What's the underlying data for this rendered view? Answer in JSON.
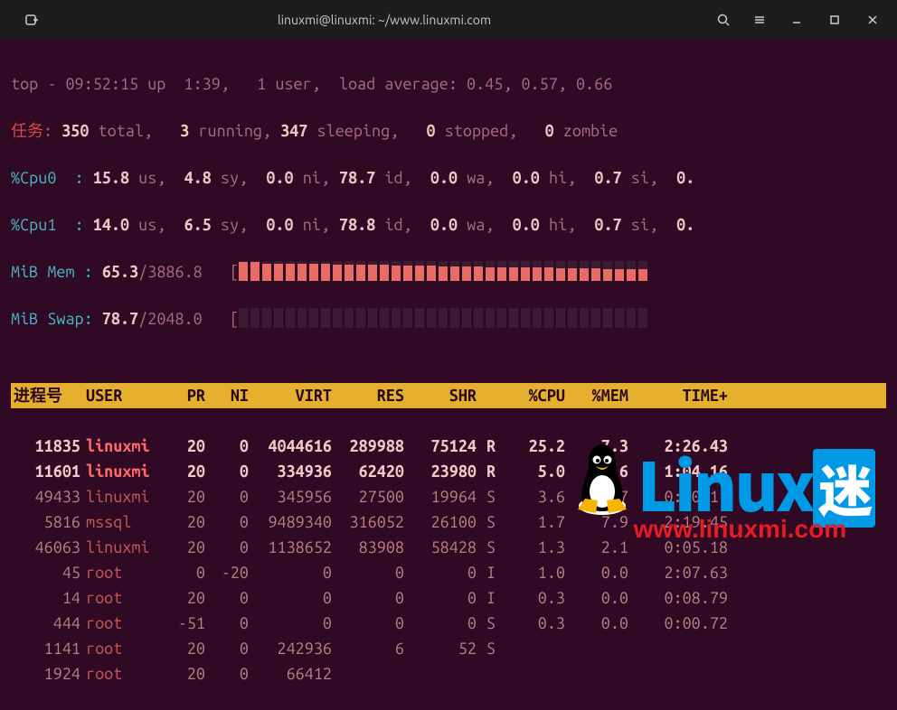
{
  "titlebar": {
    "title": "linuxmi@linuxmi: ~/www.linuxmi.com"
  },
  "top": {
    "line": "top - 09:52:15 up  1:39,   1 user,  load average: 0.45, 0.57, 0.66",
    "tasks": {
      "label": "任务:",
      "total": "350",
      "running": "3",
      "sleeping": "347",
      "stopped": "0",
      "zombie": "0"
    },
    "cpu0": {
      "label": "%Cpu0  :",
      "us": "15.8",
      "sy": "4.8",
      "ni": "0.0",
      "id": "78.7",
      "wa": "0.0",
      "hi": "0.0",
      "si": "0.7",
      "st": "0."
    },
    "cpu1": {
      "label": "%Cpu1  :",
      "us": "14.0",
      "sy": "6.5",
      "ni": "0.0",
      "id": "78.8",
      "wa": "0.0",
      "hi": "0.0",
      "si": "0.7",
      "st": "0."
    },
    "mem": {
      "label": "MiB Mem :",
      "used": "65.3",
      "total": "3886.8"
    },
    "swap": {
      "label": "MiB Swap:",
      "used": "78.7",
      "total": "2048.0"
    }
  },
  "words": {
    "total": "total,",
    "running": "running,",
    "sleeping": "sleeping,",
    "stopped": "stopped,",
    "zombie": "zombie",
    "us": "us,",
    "sy": "sy,",
    "ni": "ni,",
    "id": "id,",
    "wa": "wa,",
    "hi": "hi,",
    "si": "si,"
  },
  "headers": {
    "pid": "进程号",
    "user": "USER",
    "pr": "PR",
    "ni": "NI",
    "virt": "VIRT",
    "res": "RES",
    "shr": "SHR",
    "cpu": "%CPU",
    "mem": "%MEM",
    "time": "TIME+"
  },
  "procs": [
    {
      "bold": true,
      "pid": "11835",
      "user": "linuxmi",
      "pr": "20",
      "ni": "0",
      "virt": "4044616",
      "res": "289988",
      "shr": "75124",
      "s": "R",
      "cpu": "25.2",
      "mem": "7.3",
      "time": "2:26.43"
    },
    {
      "bold": true,
      "pid": "11601",
      "user": "linuxmi",
      "pr": "20",
      "ni": "0",
      "virt": "334936",
      "res": "62420",
      "shr": "23980",
      "s": "R",
      "cpu": "5.0",
      "mem": "1.6",
      "time": "1:04.16"
    },
    {
      "bold": false,
      "pid": "49433",
      "user": "linuxmi",
      "pr": "20",
      "ni": "0",
      "virt": "345956",
      "res": "27500",
      "shr": "19964",
      "s": "S",
      "cpu": "3.6",
      "mem": "0.7",
      "time": "0:00.11"
    },
    {
      "bold": false,
      "pid": "5816",
      "user": "mssql",
      "pr": "20",
      "ni": "0",
      "virt": "9489340",
      "res": "316052",
      "shr": "26100",
      "s": "S",
      "cpu": "1.7",
      "mem": "7.9",
      "time": "2:19.45"
    },
    {
      "bold": false,
      "pid": "46063",
      "user": "linuxmi",
      "pr": "20",
      "ni": "0",
      "virt": "1138652",
      "res": "83908",
      "shr": "58428",
      "s": "S",
      "cpu": "1.3",
      "mem": "2.1",
      "time": "0:05.18"
    },
    {
      "bold": false,
      "pid": "45",
      "user": "root",
      "pr": "0",
      "ni": "-20",
      "virt": "0",
      "res": "0",
      "shr": "0",
      "s": "I",
      "cpu": "1.0",
      "mem": "0.0",
      "time": "2:07.63"
    },
    {
      "bold": false,
      "pid": "14",
      "user": "root",
      "pr": "20",
      "ni": "0",
      "virt": "0",
      "res": "0",
      "shr": "0",
      "s": "I",
      "cpu": "0.3",
      "mem": "0.0",
      "time": "0:08.79"
    },
    {
      "bold": false,
      "pid": "444",
      "user": "root",
      "pr": "-51",
      "ni": "0",
      "virt": "0",
      "res": "0",
      "shr": "0",
      "s": "S",
      "cpu": "0.3",
      "mem": "0.0",
      "time": "0:00.72"
    },
    {
      "bold": false,
      "pid": "1141",
      "user": "root",
      "pr": "20",
      "ni": "0",
      "virt": "242936",
      "res": "6",
      "shr": "52",
      "s": "S",
      "cpu": "",
      "mem": "",
      "time": ""
    },
    {
      "bold": false,
      "pid": "1924",
      "user": "root",
      "pr": "20",
      "ni": "0",
      "virt": "66412",
      "res": "",
      "shr": "",
      "s": "",
      "cpu": "",
      "mem": "",
      "time": ""
    }
  ],
  "membar": {
    "cells": 35,
    "fills": [
      95,
      95,
      90,
      90,
      90,
      88,
      88,
      88,
      85,
      85,
      85,
      82,
      82,
      80,
      80,
      78,
      78,
      76,
      76,
      74,
      74,
      72,
      72,
      70,
      70,
      68,
      68,
      66,
      66,
      64,
      64,
      62,
      62,
      60,
      60
    ]
  },
  "swapbar": {
    "cells": 35,
    "fill": 0
  },
  "watermark": {
    "text1": "Linux",
    "text2": "迷",
    "url": "www.linuxmi.com"
  }
}
